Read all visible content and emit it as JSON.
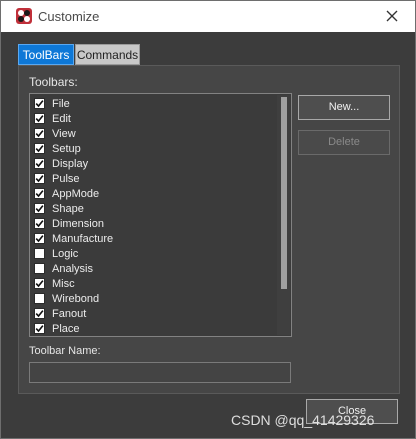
{
  "window": {
    "title": "Customize",
    "title_bar_color": "#ffffff",
    "background_color": "#3c3c3c",
    "accent_color": "#0e78d7"
  },
  "tabs": [
    {
      "label": "ToolBars",
      "selected": true
    },
    {
      "label": "Commands",
      "selected": false
    }
  ],
  "toolbars_panel": {
    "list_label": "Toolbars:",
    "items": [
      {
        "label": "File",
        "checked": true
      },
      {
        "label": "Edit",
        "checked": true
      },
      {
        "label": "View",
        "checked": true
      },
      {
        "label": "Setup",
        "checked": true
      },
      {
        "label": "Display",
        "checked": true
      },
      {
        "label": "Pulse",
        "checked": true
      },
      {
        "label": "AppMode",
        "checked": true
      },
      {
        "label": "Shape",
        "checked": true
      },
      {
        "label": "Dimension",
        "checked": true
      },
      {
        "label": "Manufacture",
        "checked": true
      },
      {
        "label": "Logic",
        "checked": false
      },
      {
        "label": "Analysis",
        "checked": false
      },
      {
        "label": "Misc",
        "checked": true
      },
      {
        "label": "Wirebond",
        "checked": false
      },
      {
        "label": "Fanout",
        "checked": true
      },
      {
        "label": "Place",
        "checked": true
      }
    ],
    "new_button": "New...",
    "delete_button": "Delete",
    "delete_enabled": false,
    "name_label": "Toolbar Name:",
    "name_value": ""
  },
  "footer": {
    "close_button": "Close"
  },
  "watermark": "CSDN @qq_41429326",
  "icons": {
    "app": "app-logo-icon",
    "close": "close-icon",
    "check": "checkmark-icon"
  }
}
